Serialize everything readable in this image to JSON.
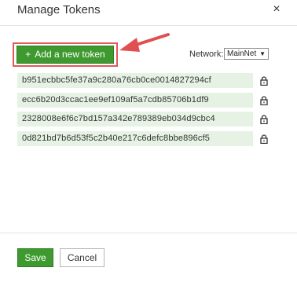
{
  "dialog": {
    "title": "Manage Tokens",
    "close_label": "×"
  },
  "toolbar": {
    "add_icon": "+",
    "add_label": "Add a new token",
    "network_label": "Network:",
    "network_selected": "MainNet",
    "network_caret": "▼"
  },
  "tokens": [
    {
      "address": "b951ecbbc5fe37a9c280a76cb0ce0014827294cf",
      "icon": "lock-icon"
    },
    {
      "address": "ecc6b20d3ccac1ee9ef109af5a7cdb85706b1df9",
      "icon": "lock-icon"
    },
    {
      "address": "2328008e6f6c7bd157a342e789389eb034d9cbc4",
      "icon": "lock-icon"
    },
    {
      "address": "0d821bd7b6d53f5c2b40e217c6defc8bbe896cf5",
      "icon": "lock-icon"
    }
  ],
  "footer": {
    "save_label": "Save",
    "cancel_label": "Cancel"
  },
  "colors": {
    "primary_green": "#3e9a2f",
    "row_background": "#e6f3e4",
    "highlight_red": "#e05a5a"
  }
}
